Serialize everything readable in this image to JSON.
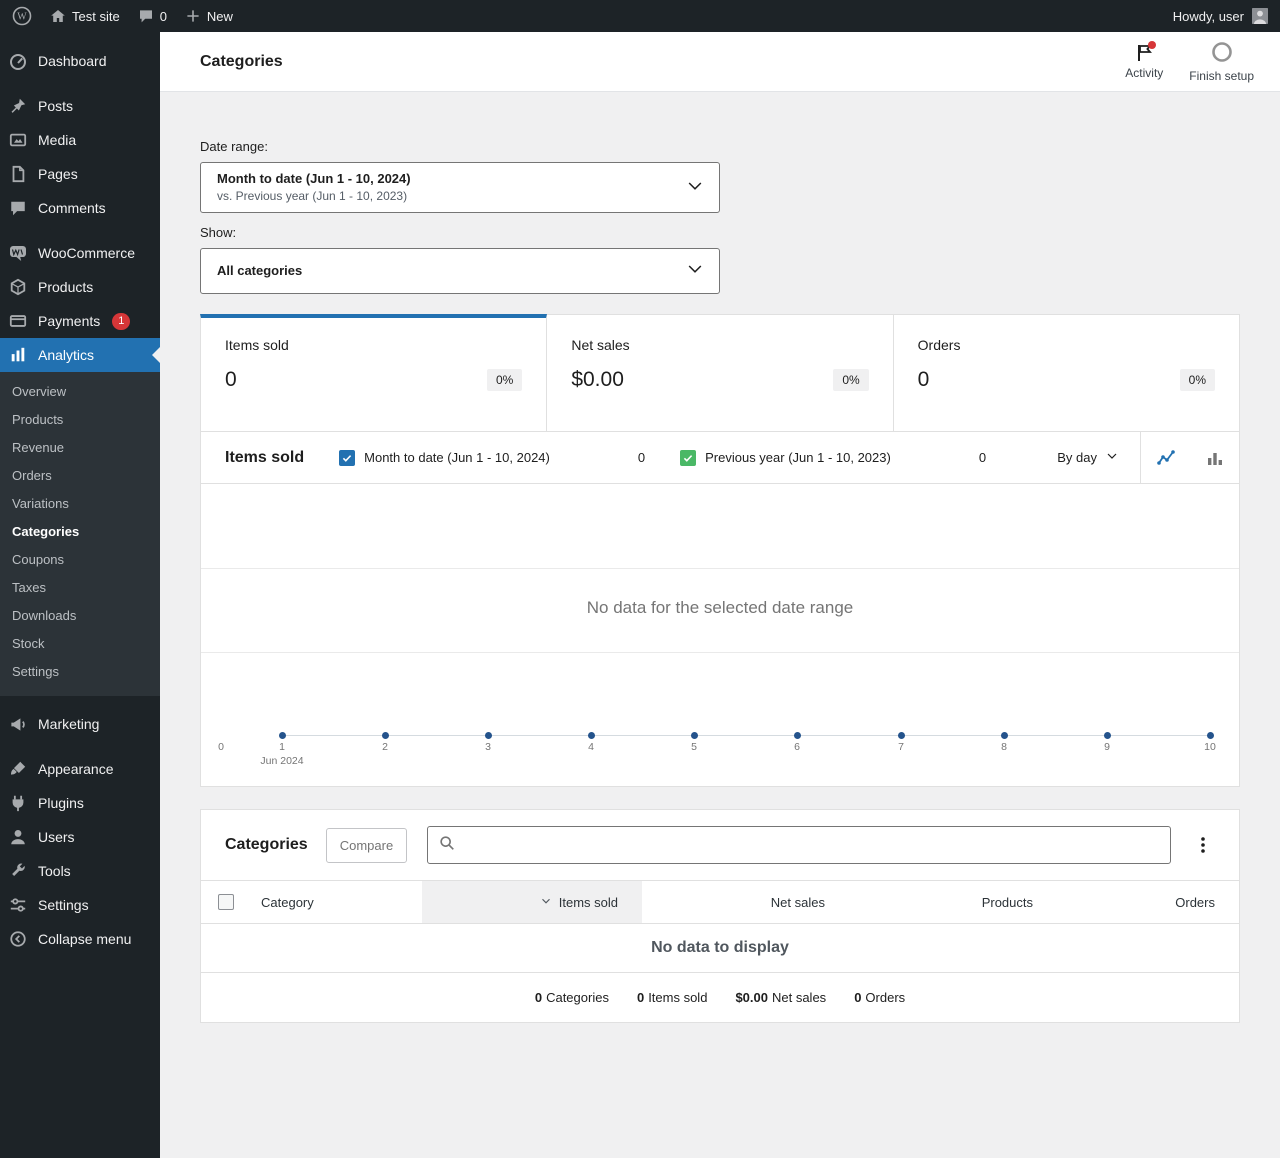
{
  "admin_bar": {
    "site_name": "Test site",
    "comments_count": "0",
    "new_label": "New",
    "howdy_text": "Howdy, user"
  },
  "sidebar": {
    "items": [
      {
        "label": "Dashboard"
      },
      {
        "label": "Posts"
      },
      {
        "label": "Media"
      },
      {
        "label": "Pages"
      },
      {
        "label": "Comments"
      },
      {
        "label": "WooCommerce"
      },
      {
        "label": "Products"
      },
      {
        "label": "Payments",
        "badge": "1"
      },
      {
        "label": "Analytics",
        "active": true
      },
      {
        "label": "Marketing"
      },
      {
        "label": "Appearance"
      },
      {
        "label": "Plugins"
      },
      {
        "label": "Users"
      },
      {
        "label": "Tools"
      },
      {
        "label": "Settings"
      },
      {
        "label": "Collapse menu"
      }
    ],
    "analytics_submenu": [
      {
        "label": "Overview"
      },
      {
        "label": "Products"
      },
      {
        "label": "Revenue"
      },
      {
        "label": "Orders"
      },
      {
        "label": "Variations"
      },
      {
        "label": "Categories",
        "active": true
      },
      {
        "label": "Coupons"
      },
      {
        "label": "Taxes"
      },
      {
        "label": "Downloads"
      },
      {
        "label": "Stock"
      },
      {
        "label": "Settings"
      }
    ]
  },
  "header": {
    "title": "Categories",
    "activity": "Activity",
    "finish_setup": "Finish setup"
  },
  "filters": {
    "date_range_label": "Date range:",
    "date_range_primary": "Month to date (Jun 1 - 10, 2024)",
    "date_range_secondary": "vs. Previous year (Jun 1 - 10, 2023)",
    "show_label": "Show:",
    "show_value": "All categories"
  },
  "stats": [
    {
      "label": "Items sold",
      "value": "0",
      "delta": "0%",
      "active": true
    },
    {
      "label": "Net sales",
      "value": "$0.00",
      "delta": "0%"
    },
    {
      "label": "Orders",
      "value": "0",
      "delta": "0%"
    }
  ],
  "chart": {
    "title": "Items sold",
    "legend": [
      {
        "label": "Month to date (Jun 1 - 10, 2024)",
        "value": "0",
        "color": "#2271b1",
        "checked": true
      },
      {
        "label": "Previous year (Jun 1 - 10, 2023)",
        "value": "0",
        "color": "#4ab866",
        "checked": true
      }
    ],
    "interval": "By day",
    "empty_message": "No data for the selected date range",
    "x_ticks": [
      "0",
      "1",
      "2",
      "3",
      "4",
      "5",
      "6",
      "7",
      "8",
      "9",
      "10"
    ],
    "x_axis_sublabel": "Jun 2024"
  },
  "table": {
    "title": "Categories",
    "compare_label": "Compare",
    "search_placeholder": "",
    "columns": [
      "Category",
      "Items sold",
      "Net sales",
      "Products",
      "Orders"
    ],
    "sorted_column": "Items sold",
    "empty_message": "No data to display",
    "summary": [
      {
        "value": "0",
        "label": "Categories"
      },
      {
        "value": "0",
        "label": "Items sold"
      },
      {
        "value": "$0.00",
        "label": "Net sales"
      },
      {
        "value": "0",
        "label": "Orders"
      }
    ]
  }
}
